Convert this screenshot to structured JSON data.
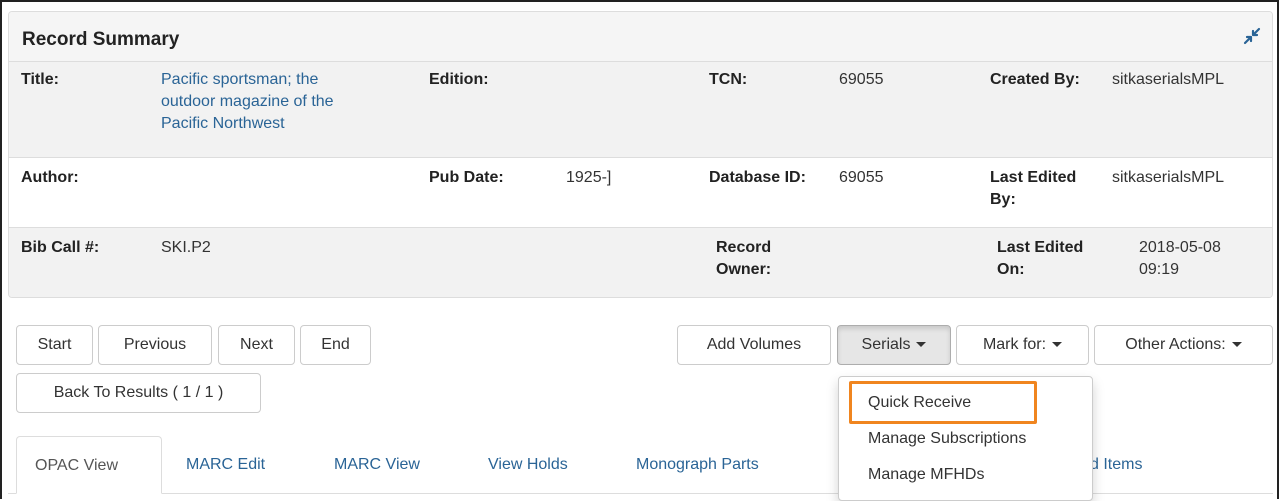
{
  "panel": {
    "title": "Record Summary",
    "collapse_icon": "collapse-arrows-icon"
  },
  "summary": {
    "title_label": "Title:",
    "title_value_lines": [
      "Pacific sportsman; the",
      "outdoor magazine of the",
      "Pacific Northwest"
    ],
    "edition_label": "Edition:",
    "edition_value": "",
    "tcn_label": "TCN:",
    "tcn_value": "69055",
    "created_by_label": "Created By:",
    "created_by_value": "sitkaserialsMPL",
    "author_label": "Author:",
    "author_value": "",
    "pub_date_label": "Pub Date:",
    "pub_date_value": "1925-]",
    "database_id_label": "Database ID:",
    "database_id_value": "69055",
    "last_edited_by_label_lines": [
      "Last Edited",
      "By:"
    ],
    "last_edited_by_value": "sitkaserialsMPL",
    "bib_call_label": "Bib Call #:",
    "bib_call_value": "SKI.P2",
    "record_owner_label_lines": [
      "Record",
      "Owner:"
    ],
    "record_owner_value": "",
    "last_edited_on_label_lines": [
      "Last Edited",
      "On:"
    ],
    "last_edited_on_value_lines": [
      "2018-05-08",
      "09:19"
    ]
  },
  "nav": {
    "start": "Start",
    "previous": "Previous",
    "next": "Next",
    "end": "End",
    "back_to_results": "Back To Results ( 1 / 1 )"
  },
  "actions": {
    "add_volumes": "Add Volumes",
    "serials": "Serials",
    "mark_for": "Mark for:",
    "other_actions": "Other Actions:"
  },
  "serials_menu": {
    "items": [
      "Quick Receive",
      "Manage Subscriptions",
      "Manage MFHDs"
    ],
    "highlight_color": "#f0851f"
  },
  "tabs": {
    "items": [
      "OPAC View",
      "MARC Edit",
      "MARC View",
      "View Holds",
      "Monograph Parts",
      "d Items"
    ],
    "active": "OPAC View"
  }
}
